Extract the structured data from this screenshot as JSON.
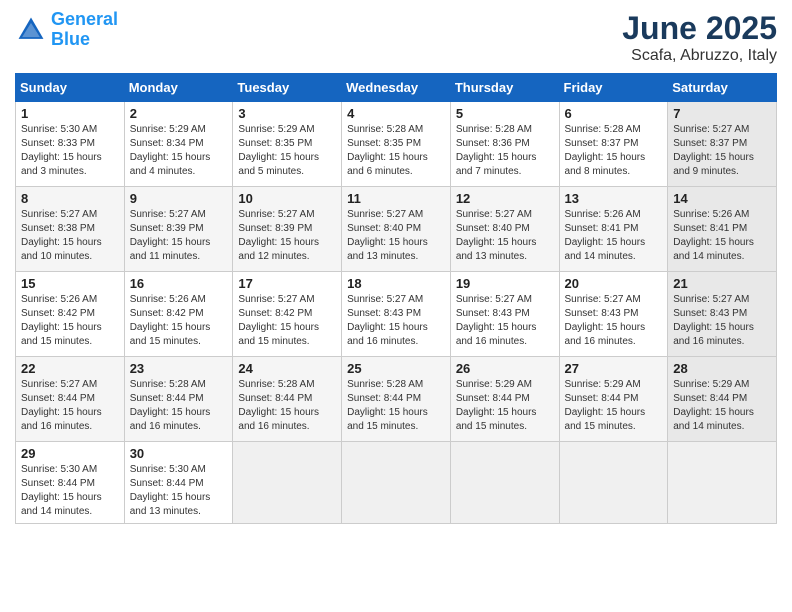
{
  "header": {
    "logo_line1": "General",
    "logo_line2": "Blue",
    "month": "June 2025",
    "location": "Scafa, Abruzzo, Italy"
  },
  "columns": [
    "Sunday",
    "Monday",
    "Tuesday",
    "Wednesday",
    "Thursday",
    "Friday",
    "Saturday"
  ],
  "weeks": [
    [
      {
        "day": "1",
        "lines": [
          "Sunrise: 5:30 AM",
          "Sunset: 8:33 PM",
          "Daylight: 15 hours",
          "and 3 minutes."
        ]
      },
      {
        "day": "2",
        "lines": [
          "Sunrise: 5:29 AM",
          "Sunset: 8:34 PM",
          "Daylight: 15 hours",
          "and 4 minutes."
        ]
      },
      {
        "day": "3",
        "lines": [
          "Sunrise: 5:29 AM",
          "Sunset: 8:35 PM",
          "Daylight: 15 hours",
          "and 5 minutes."
        ]
      },
      {
        "day": "4",
        "lines": [
          "Sunrise: 5:28 AM",
          "Sunset: 8:35 PM",
          "Daylight: 15 hours",
          "and 6 minutes."
        ]
      },
      {
        "day": "5",
        "lines": [
          "Sunrise: 5:28 AM",
          "Sunset: 8:36 PM",
          "Daylight: 15 hours",
          "and 7 minutes."
        ]
      },
      {
        "day": "6",
        "lines": [
          "Sunrise: 5:28 AM",
          "Sunset: 8:37 PM",
          "Daylight: 15 hours",
          "and 8 minutes."
        ]
      },
      {
        "day": "7",
        "lines": [
          "Sunrise: 5:27 AM",
          "Sunset: 8:37 PM",
          "Daylight: 15 hours",
          "and 9 minutes."
        ]
      }
    ],
    [
      {
        "day": "8",
        "lines": [
          "Sunrise: 5:27 AM",
          "Sunset: 8:38 PM",
          "Daylight: 15 hours",
          "and 10 minutes."
        ]
      },
      {
        "day": "9",
        "lines": [
          "Sunrise: 5:27 AM",
          "Sunset: 8:39 PM",
          "Daylight: 15 hours",
          "and 11 minutes."
        ]
      },
      {
        "day": "10",
        "lines": [
          "Sunrise: 5:27 AM",
          "Sunset: 8:39 PM",
          "Daylight: 15 hours",
          "and 12 minutes."
        ]
      },
      {
        "day": "11",
        "lines": [
          "Sunrise: 5:27 AM",
          "Sunset: 8:40 PM",
          "Daylight: 15 hours",
          "and 13 minutes."
        ]
      },
      {
        "day": "12",
        "lines": [
          "Sunrise: 5:27 AM",
          "Sunset: 8:40 PM",
          "Daylight: 15 hours",
          "and 13 minutes."
        ]
      },
      {
        "day": "13",
        "lines": [
          "Sunrise: 5:26 AM",
          "Sunset: 8:41 PM",
          "Daylight: 15 hours",
          "and 14 minutes."
        ]
      },
      {
        "day": "14",
        "lines": [
          "Sunrise: 5:26 AM",
          "Sunset: 8:41 PM",
          "Daylight: 15 hours",
          "and 14 minutes."
        ]
      }
    ],
    [
      {
        "day": "15",
        "lines": [
          "Sunrise: 5:26 AM",
          "Sunset: 8:42 PM",
          "Daylight: 15 hours",
          "and 15 minutes."
        ]
      },
      {
        "day": "16",
        "lines": [
          "Sunrise: 5:26 AM",
          "Sunset: 8:42 PM",
          "Daylight: 15 hours",
          "and 15 minutes."
        ]
      },
      {
        "day": "17",
        "lines": [
          "Sunrise: 5:27 AM",
          "Sunset: 8:42 PM",
          "Daylight: 15 hours",
          "and 15 minutes."
        ]
      },
      {
        "day": "18",
        "lines": [
          "Sunrise: 5:27 AM",
          "Sunset: 8:43 PM",
          "Daylight: 15 hours",
          "and 16 minutes."
        ]
      },
      {
        "day": "19",
        "lines": [
          "Sunrise: 5:27 AM",
          "Sunset: 8:43 PM",
          "Daylight: 15 hours",
          "and 16 minutes."
        ]
      },
      {
        "day": "20",
        "lines": [
          "Sunrise: 5:27 AM",
          "Sunset: 8:43 PM",
          "Daylight: 15 hours",
          "and 16 minutes."
        ]
      },
      {
        "day": "21",
        "lines": [
          "Sunrise: 5:27 AM",
          "Sunset: 8:43 PM",
          "Daylight: 15 hours",
          "and 16 minutes."
        ]
      }
    ],
    [
      {
        "day": "22",
        "lines": [
          "Sunrise: 5:27 AM",
          "Sunset: 8:44 PM",
          "Daylight: 15 hours",
          "and 16 minutes."
        ]
      },
      {
        "day": "23",
        "lines": [
          "Sunrise: 5:28 AM",
          "Sunset: 8:44 PM",
          "Daylight: 15 hours",
          "and 16 minutes."
        ]
      },
      {
        "day": "24",
        "lines": [
          "Sunrise: 5:28 AM",
          "Sunset: 8:44 PM",
          "Daylight: 15 hours",
          "and 16 minutes."
        ]
      },
      {
        "day": "25",
        "lines": [
          "Sunrise: 5:28 AM",
          "Sunset: 8:44 PM",
          "Daylight: 15 hours",
          "and 15 minutes."
        ]
      },
      {
        "day": "26",
        "lines": [
          "Sunrise: 5:29 AM",
          "Sunset: 8:44 PM",
          "Daylight: 15 hours",
          "and 15 minutes."
        ]
      },
      {
        "day": "27",
        "lines": [
          "Sunrise: 5:29 AM",
          "Sunset: 8:44 PM",
          "Daylight: 15 hours",
          "and 15 minutes."
        ]
      },
      {
        "day": "28",
        "lines": [
          "Sunrise: 5:29 AM",
          "Sunset: 8:44 PM",
          "Daylight: 15 hours",
          "and 14 minutes."
        ]
      }
    ],
    [
      {
        "day": "29",
        "lines": [
          "Sunrise: 5:30 AM",
          "Sunset: 8:44 PM",
          "Daylight: 15 hours",
          "and 14 minutes."
        ]
      },
      {
        "day": "30",
        "lines": [
          "Sunrise: 5:30 AM",
          "Sunset: 8:44 PM",
          "Daylight: 15 hours",
          "and 13 minutes."
        ]
      },
      {
        "day": "",
        "lines": []
      },
      {
        "day": "",
        "lines": []
      },
      {
        "day": "",
        "lines": []
      },
      {
        "day": "",
        "lines": []
      },
      {
        "day": "",
        "lines": []
      }
    ]
  ]
}
